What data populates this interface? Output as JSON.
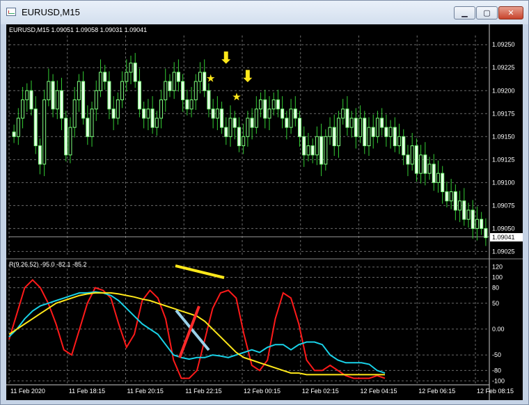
{
  "window": {
    "title": "EURUSD,M15",
    "minimize_icon": "minimize-icon",
    "maximize_icon": "maximize-icon",
    "close_icon": "close-icon"
  },
  "main_panel": {
    "header": "EURUSD,M15  1.09051 1.09058 1.09031 1.09041",
    "current_price": "1.09041"
  },
  "indicator_panel": {
    "header": "R(9,26,52) -95.0 -82.1 -85.2"
  },
  "chart_data": [
    {
      "type": "candlestick",
      "title": "EURUSD,M15",
      "ohlc_last": [
        1.09051,
        1.09058,
        1.09031,
        1.09041
      ],
      "y_ticks": [
        "1.09250",
        "1.09225",
        "1.09200",
        "1.09175",
        "1.09150",
        "1.09125",
        "1.09100",
        "1.09075",
        "1.09050",
        "1.09025"
      ],
      "ylim": [
        1.0902,
        1.0926
      ],
      "closes": [
        1.0915,
        1.0917,
        1.0919,
        1.092,
        1.0918,
        1.0914,
        1.0912,
        1.0919,
        1.0921,
        1.0918,
        1.092,
        1.0917,
        1.0913,
        1.0916,
        1.0919,
        1.0921,
        1.0917,
        1.0915,
        1.0918,
        1.092,
        1.0922,
        1.0921,
        1.0918,
        1.0917,
        1.0919,
        1.0921,
        1.0922,
        1.0923,
        1.0921,
        1.0918,
        1.0917,
        1.0918,
        1.0916,
        1.0917,
        1.0919,
        1.0921,
        1.092,
        1.0922,
        1.0921,
        1.0919,
        1.0918,
        1.0919,
        1.0921,
        1.0922,
        1.092,
        1.0918,
        1.0917,
        1.0918,
        1.0916,
        1.0915,
        1.0917,
        1.0916,
        1.0914,
        1.0915,
        1.0917,
        1.0916,
        1.0918,
        1.0919,
        1.0917,
        1.0918,
        1.0919,
        1.0918,
        1.0917,
        1.0916,
        1.0918,
        1.0917,
        1.0915,
        1.0913,
        1.0914,
        1.0913,
        1.0915,
        1.0912,
        1.0915,
        1.0916,
        1.0914,
        1.0917,
        1.0918,
        1.0916,
        1.0917,
        1.0915,
        1.0917,
        1.0914,
        1.0916,
        1.0915,
        1.0917,
        1.0916,
        1.0915,
        1.0916,
        1.0914,
        1.0915,
        1.0913,
        1.0912,
        1.0914,
        1.0911,
        1.0913,
        1.0911,
        1.0912,
        1.091,
        1.0911,
        1.0909,
        1.0908,
        1.0909,
        1.0907,
        1.0908,
        1.0906,
        1.0907,
        1.0905,
        1.0906,
        1.0905,
        1.0904
      ],
      "signal_markers": [
        "star",
        "arrow-down",
        "star",
        "arrow-down"
      ]
    },
    {
      "type": "line",
      "title": "R(9,26,52)",
      "ylim": [
        -105,
        125
      ],
      "y_ticks": [
        "120",
        "100",
        "80",
        "50",
        "0.00",
        "-50",
        "-80",
        "-100"
      ],
      "x_ticks": [
        "11 Feb 2020",
        "11 Feb 18:15",
        "11 Feb 20:15",
        "11 Feb 22:15",
        "12 Feb 00:15",
        "12 Feb 02:15",
        "12 Feb 04:15",
        "12 Feb 06:15",
        "12 Feb 08:15"
      ],
      "series": [
        {
          "name": "9",
          "color": "#ff1a1a",
          "values": [
            -20,
            30,
            80,
            95,
            80,
            50,
            10,
            -40,
            -50,
            0,
            50,
            80,
            75,
            60,
            10,
            -35,
            -10,
            55,
            75,
            60,
            20,
            -60,
            -95,
            -95,
            -80,
            -20,
            40,
            70,
            75,
            60,
            -10,
            -70,
            -80,
            -60,
            20,
            70,
            60,
            10,
            -60,
            -80,
            -80,
            -70,
            -80,
            -90,
            -95,
            -95,
            -95,
            -90,
            -95
          ]
        },
        {
          "name": "26",
          "color": "#19d2e8",
          "values": [
            -15,
            0,
            20,
            35,
            45,
            50,
            55,
            60,
            65,
            70,
            70,
            72,
            70,
            65,
            55,
            40,
            25,
            10,
            0,
            -10,
            -30,
            -50,
            -55,
            -58,
            -55,
            -55,
            -50,
            -52,
            -55,
            -50,
            -45,
            -40,
            -45,
            -35,
            -30,
            -30,
            -40,
            -30,
            -25,
            -25,
            -30,
            -50,
            -60,
            -65,
            -65,
            -65,
            -68,
            -80,
            -85
          ]
        },
        {
          "name": "52",
          "color": "#ffe81a",
          "values": [
            -10,
            0,
            10,
            20,
            30,
            40,
            50,
            55,
            60,
            65,
            68,
            70,
            70,
            70,
            68,
            65,
            62,
            58,
            55,
            50,
            45,
            40,
            35,
            30,
            25,
            15,
            0,
            -15,
            -30,
            -45,
            -55,
            -60,
            -65,
            -70,
            -75,
            -80,
            -85,
            -85,
            -88,
            -88,
            -88,
            -88,
            -88,
            -88,
            -88,
            -88,
            -88,
            -88,
            -88
          ]
        }
      ]
    }
  ]
}
